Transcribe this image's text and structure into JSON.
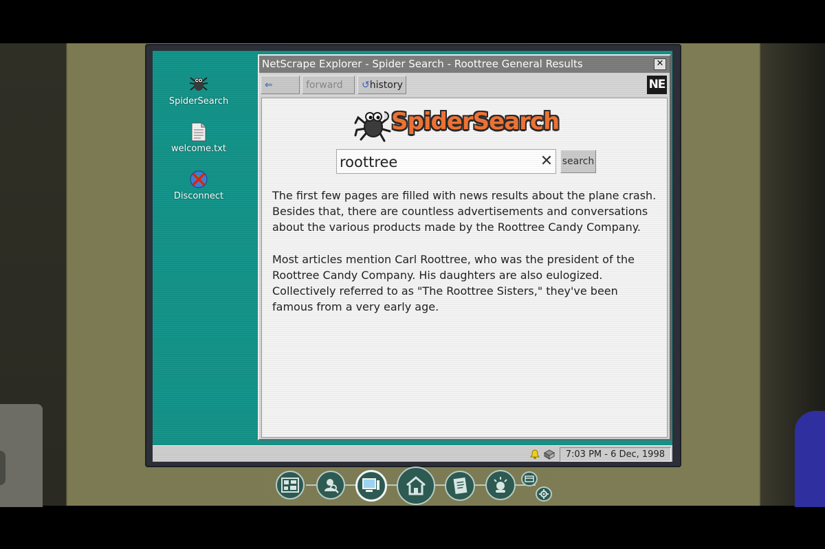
{
  "desktop": {
    "icons": [
      {
        "label": "SpiderSearch",
        "icon": "spider-icon"
      },
      {
        "label": "welcome.txt",
        "icon": "text-file-icon"
      },
      {
        "label": "Disconnect",
        "icon": "disconnect-globe-icon"
      }
    ]
  },
  "browser": {
    "title": "NetScrape Explorer - Spider Search - Roottree General Results",
    "close_label": "✕",
    "toolbar": {
      "back_label": "back",
      "forward_label": "forward",
      "history_label": "history",
      "logo_label": "NE"
    },
    "page": {
      "logo_text": "SpiderSearch",
      "search_value": "roottree",
      "clear_label": "✕",
      "search_button": "search",
      "paragraphs": [
        "The first few pages are filled with news results about the plane crash. Besides that, there are countless advertisements and conversations about the various products made by the Roottree Candy Company.",
        "Most articles mention Carl Roottree, who was the president of the Roottree Candy Company. His daughters are also eulogized. Collectively referred to as \"The Roottree Sisters,\" they've been famous from a very early age."
      ]
    }
  },
  "taskbar": {
    "clock": "7:03 PM - 6 Dec, 1998"
  },
  "dock": {
    "buttons": [
      "evidence-board-icon",
      "suspect-search-icon",
      "computer-icon",
      "home-icon",
      "notebook-icon",
      "hint-icon",
      "card-icon",
      "settings-gear-icon"
    ]
  },
  "colors": {
    "desktop": "#14948a",
    "logo_orange": "#f07436",
    "dock_fill": "#2d5a52"
  }
}
